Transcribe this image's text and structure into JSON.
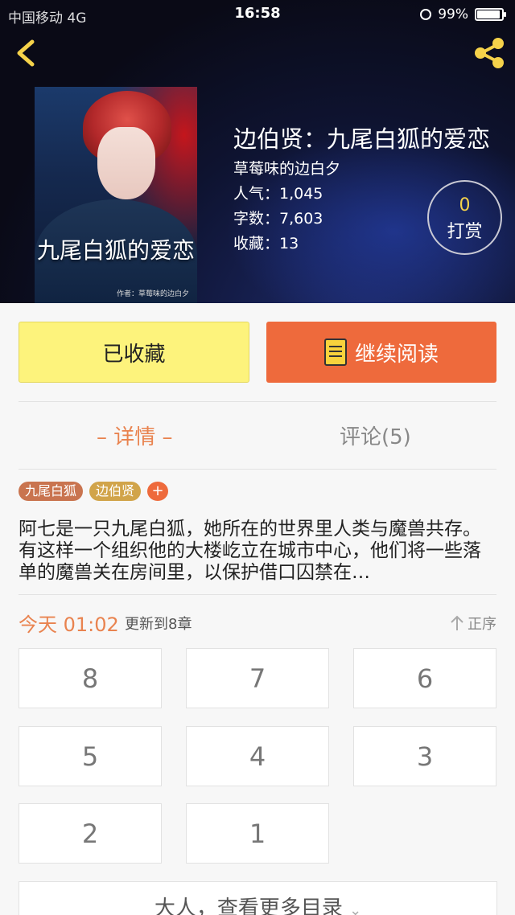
{
  "status_bar": {
    "carrier": "中国移动 4G",
    "time": "16:58",
    "battery": "99%"
  },
  "book": {
    "cover_title": "九尾白狐的爱恋",
    "cover_author": "作者：草莓味的边白夕",
    "title": "边伯贤：九尾白狐的爱恋",
    "author": "草莓味的边白夕",
    "popularity": "人气：1,045",
    "word_count": "字数：7,603",
    "favorites": "收藏：13"
  },
  "reward": {
    "count": "0",
    "label": "打赏"
  },
  "actions": {
    "favorite": "已收藏",
    "continue_reading": "继续阅读"
  },
  "tabs": {
    "detail": "– 详情 –",
    "comments": "评论(5)"
  },
  "tags": [
    "九尾白狐",
    "边伯贤",
    "+"
  ],
  "description": "阿七是一只九尾白狐，她所在的世界里人类与魔兽共存。有这样一个组织他的大楼屹立在城市中心，他们将一些落单的魔兽关在房间里，以保护借口囚禁在…",
  "update": {
    "time": "今天 01:02",
    "text": "更新到8章",
    "sort": "正序"
  },
  "chapters": [
    "8",
    "7",
    "6",
    "5",
    "4",
    "3",
    "2",
    "1"
  ],
  "more_catalog": "大人，查看更多目录",
  "colors": {
    "accent": "#ee6a3c",
    "favorite_bg": "#fdf37c",
    "tab_active": "#e9834f"
  }
}
